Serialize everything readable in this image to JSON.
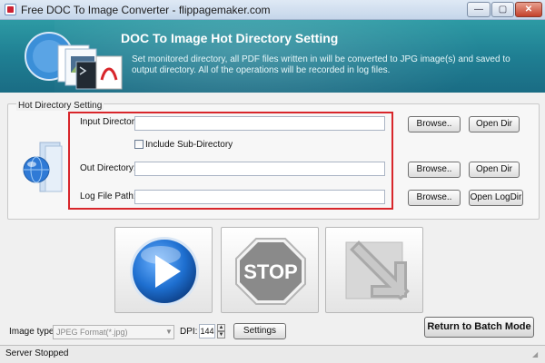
{
  "window": {
    "title": "Free DOC To Image Converter - flippagemaker.com",
    "minimize": "—",
    "maximize": "▢",
    "close": "✕"
  },
  "banner": {
    "title": "DOC To Image Hot Directory Setting",
    "description": "Set monitored directory, all PDF files written in will be converted to JPG image(s) and saved to output directory. All of the operations will be recorded in log files."
  },
  "hot_directory": {
    "group_label": "Hot Directory Setting",
    "input_label": "Input Directory:",
    "input_value": "",
    "include_sub_label": "Include Sub-Directory",
    "include_sub_checked": false,
    "out_label": "Out Directory:",
    "out_value": "",
    "log_label": "Log File Path:",
    "log_value": "",
    "browse_label": "Browse..",
    "open_dir_label": "Open Dir",
    "open_logdir_label": "Open LogDir"
  },
  "actions": {
    "play": "play-icon",
    "stop_text": "STOP",
    "export": "arrow-down-right-icon"
  },
  "bottom": {
    "image_type_label": "Image type:",
    "image_type_value": "JPEG Format(*.jpg)",
    "dpi_label": "DPI:",
    "dpi_value": "144",
    "settings_label": "Settings",
    "return_label": "Return to Batch Mode"
  },
  "status": {
    "text": "Server Stopped"
  },
  "colors": {
    "highlight_frame": "#d8262b",
    "banner": "#1f7f93",
    "play": "#1e6fd0",
    "stop": "#8a8a8a"
  }
}
